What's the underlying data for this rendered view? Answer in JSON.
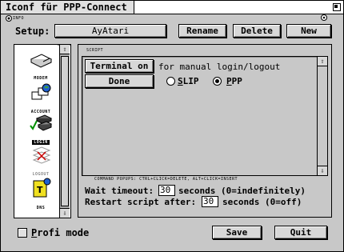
{
  "window": {
    "title": "Iconf für PPP-Connect"
  },
  "header": {
    "info_label": "INFO",
    "setup_label": "Setup:",
    "setup_value": "AyAtari",
    "rename_label": "Rename",
    "delete_label": "Delete",
    "new_label": "New"
  },
  "sidebar": {
    "items": [
      {
        "label": "MODEM",
        "icon": "modem-icon",
        "state": "normal"
      },
      {
        "label": "ACCOUNT",
        "icon": "account-icon",
        "state": "normal"
      },
      {
        "label": "LOGIN",
        "icon": "login-icon",
        "state": "selected"
      },
      {
        "label": "LOGOUT",
        "icon": "logout-icon",
        "state": "disabled"
      },
      {
        "label": "DNS",
        "icon": "dns-icon",
        "state": "normal"
      }
    ],
    "scroll": {
      "up": "⇧",
      "down": "⇩"
    }
  },
  "script": {
    "group_label": "SCRIPT",
    "terminal_button": "Terminal on",
    "terminal_desc": "for manual login/logout",
    "done_button": "Done",
    "protocols": [
      {
        "label": "SLIP",
        "selected": false
      },
      {
        "label": "PPP",
        "selected": true
      }
    ],
    "help_text": "COMMAND POPUPS: CTRL+CLICK=DELETE, ALT+CLICK=INSERT",
    "scroll": {
      "up": "⇧",
      "down": "⇩"
    }
  },
  "timeouts": {
    "wait_label": "Wait timeout:",
    "wait_value": "30",
    "wait_suffix": "seconds (0=indefinitely)",
    "restart_label": "Restart script after:",
    "restart_value": "30",
    "restart_suffix": "seconds (0=off)"
  },
  "footer": {
    "profi_label": "Profi mode",
    "profi_checked": false,
    "save_label": "Save",
    "quit_label": "Quit"
  }
}
